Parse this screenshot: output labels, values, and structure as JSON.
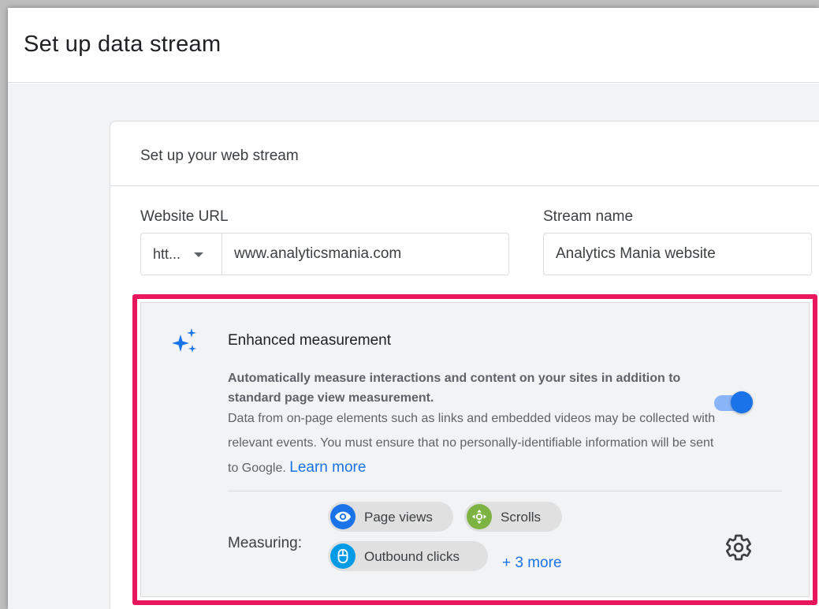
{
  "header": {
    "title": "Set up data stream"
  },
  "card": {
    "title": "Set up your web stream",
    "website_url": {
      "label": "Website URL",
      "protocol": "htt...",
      "value": "www.analyticsmania.com"
    },
    "stream_name": {
      "label": "Stream name",
      "value": "Analytics Mania website"
    }
  },
  "enhanced_measurement": {
    "title": "Enhanced measurement",
    "description_bold": "Automatically measure interactions and content on your sites in addition to standard page view measurement.",
    "description": "Data from on-page elements such as links and embedded videos may be collected with relevant events. You must ensure that no personally-identifiable information will be sent to Google.",
    "learn_more": "Learn more",
    "toggle_on": true,
    "measuring_label": "Measuring:",
    "chips": [
      {
        "label": "Page views",
        "icon": "eye-icon",
        "color": "#1a73e8"
      },
      {
        "label": "Scrolls",
        "icon": "compass-icon",
        "color": "#7cb342"
      },
      {
        "label": "Outbound clicks",
        "icon": "mouse-icon",
        "color": "#039be5"
      }
    ],
    "more": "+ 3 more"
  },
  "colors": {
    "accent": "#1a73e8",
    "highlight": "#e8175d"
  }
}
